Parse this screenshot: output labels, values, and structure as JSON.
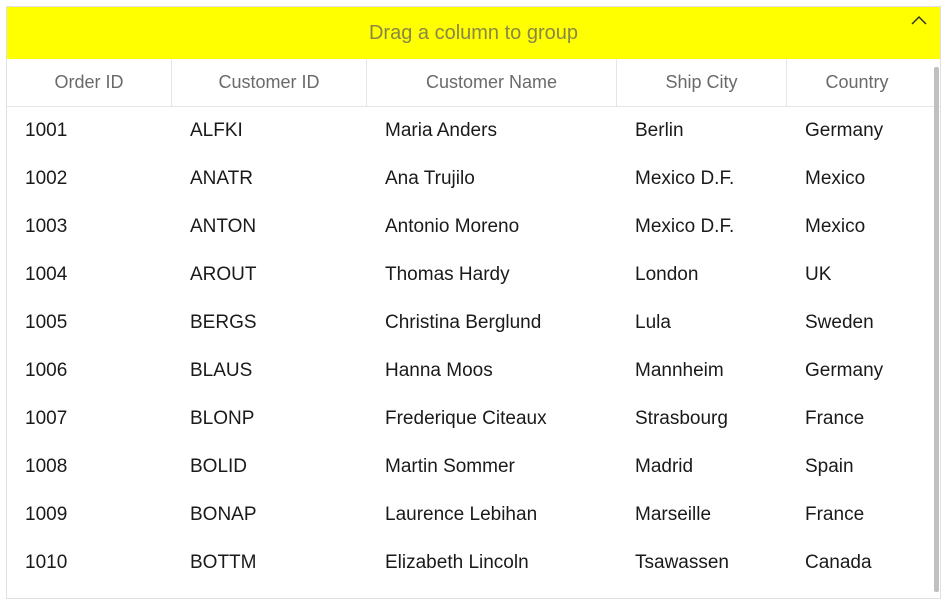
{
  "groupBar": {
    "label": "Drag a column to group"
  },
  "columns": [
    {
      "key": "orderId",
      "label": "Order ID",
      "cls": "col-orderid"
    },
    {
      "key": "customerId",
      "label": "Customer ID",
      "cls": "col-customerid"
    },
    {
      "key": "customerName",
      "label": "Customer Name",
      "cls": "col-customername"
    },
    {
      "key": "shipCity",
      "label": "Ship City",
      "cls": "col-shipcity"
    },
    {
      "key": "country",
      "label": "Country",
      "cls": "col-country"
    }
  ],
  "rows": [
    {
      "orderId": "1001",
      "customerId": "ALFKI",
      "customerName": "Maria Anders",
      "shipCity": "Berlin",
      "country": "Germany"
    },
    {
      "orderId": "1002",
      "customerId": "ANATR",
      "customerName": "Ana Trujilo",
      "shipCity": "Mexico D.F.",
      "country": "Mexico"
    },
    {
      "orderId": "1003",
      "customerId": "ANTON",
      "customerName": "Antonio Moreno",
      "shipCity": "Mexico D.F.",
      "country": "Mexico"
    },
    {
      "orderId": "1004",
      "customerId": "AROUT",
      "customerName": "Thomas Hardy",
      "shipCity": "London",
      "country": "UK"
    },
    {
      "orderId": "1005",
      "customerId": "BERGS",
      "customerName": "Christina Berglund",
      "shipCity": "Lula",
      "country": "Sweden"
    },
    {
      "orderId": "1006",
      "customerId": "BLAUS",
      "customerName": "Hanna Moos",
      "shipCity": "Mannheim",
      "country": "Germany"
    },
    {
      "orderId": "1007",
      "customerId": "BLONP",
      "customerName": "Frederique Citeaux",
      "shipCity": "Strasbourg",
      "country": "France"
    },
    {
      "orderId": "1008",
      "customerId": "BOLID",
      "customerName": "Martin Sommer",
      "shipCity": "Madrid",
      "country": "Spain"
    },
    {
      "orderId": "1009",
      "customerId": "BONAP",
      "customerName": "Laurence Lebihan",
      "shipCity": "Marseille",
      "country": "France"
    },
    {
      "orderId": "1010",
      "customerId": "BOTTM",
      "customerName": "Elizabeth Lincoln",
      "shipCity": "Tsawassen",
      "country": "Canada"
    }
  ]
}
